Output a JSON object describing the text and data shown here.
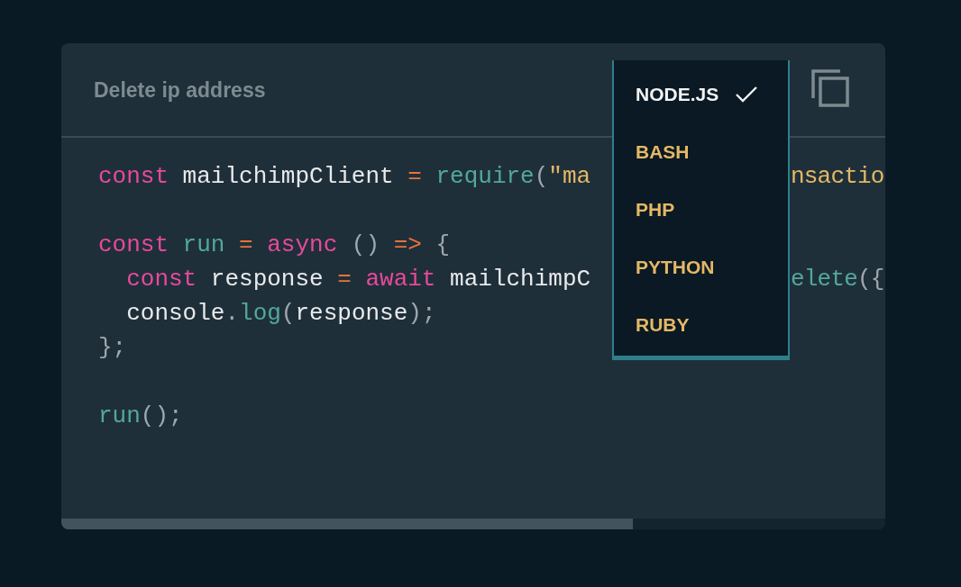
{
  "card": {
    "title": "Delete ip address"
  },
  "code": [
    {
      "kind": "code",
      "left": [
        {
          "text": "const",
          "kind": "keyword"
        },
        {
          "text": " mailchimpClient ",
          "kind": "ident"
        },
        {
          "text": "=",
          "kind": "op"
        },
        {
          "text": " require",
          "kind": "func"
        },
        {
          "text": "(",
          "kind": "punct"
        },
        {
          "text": "\"ma",
          "kind": "string"
        }
      ],
      "right": [
        {
          "text": "nsactio",
          "kind": "string"
        }
      ]
    },
    {
      "kind": "blank"
    },
    {
      "kind": "code",
      "left": [
        {
          "text": "const",
          "kind": "keyword"
        },
        {
          "text": " run ",
          "kind": "func"
        },
        {
          "text": "=",
          "kind": "op"
        },
        {
          "text": " async",
          "kind": "keyword"
        },
        {
          "text": " () ",
          "kind": "punct"
        },
        {
          "text": "=>",
          "kind": "op"
        },
        {
          "text": " {",
          "kind": "punct"
        }
      ]
    },
    {
      "kind": "code",
      "left": [
        {
          "text": "  const",
          "kind": "keyword"
        },
        {
          "text": " response ",
          "kind": "ident"
        },
        {
          "text": "=",
          "kind": "op"
        },
        {
          "text": " await",
          "kind": "keyword"
        },
        {
          "text": " mailchimpC",
          "kind": "ident"
        }
      ],
      "right": [
        {
          "text": "elete",
          "kind": "func"
        },
        {
          "text": "({",
          "kind": "punct"
        }
      ]
    },
    {
      "kind": "code",
      "left": [
        {
          "text": "  console",
          "kind": "ident"
        },
        {
          "text": ".",
          "kind": "punct"
        },
        {
          "text": "log",
          "kind": "func"
        },
        {
          "text": "(",
          "kind": "punct"
        },
        {
          "text": "response",
          "kind": "ident"
        },
        {
          "text": ");",
          "kind": "punct"
        }
      ]
    },
    {
      "kind": "code",
      "left": [
        {
          "text": "};",
          "kind": "punct"
        }
      ]
    },
    {
      "kind": "blank"
    },
    {
      "kind": "code",
      "left": [
        {
          "text": "run",
          "kind": "func"
        },
        {
          "text": "();",
          "kind": "punct"
        }
      ]
    }
  ],
  "menu": {
    "items": [
      {
        "label": "NODE.JS",
        "selected": true
      },
      {
        "label": "BASH",
        "selected": false
      },
      {
        "label": "PHP",
        "selected": false
      },
      {
        "label": "PYTHON",
        "selected": false
      },
      {
        "label": "RUBY",
        "selected": false
      }
    ]
  }
}
